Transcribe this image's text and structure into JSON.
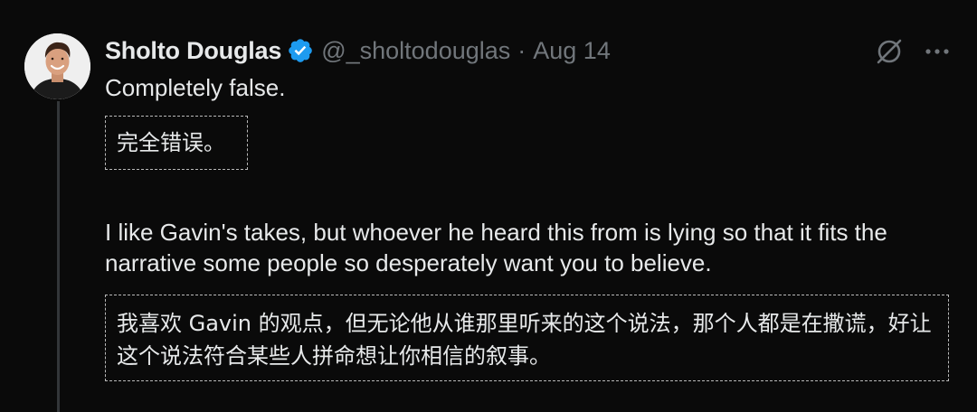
{
  "tweet": {
    "author": {
      "display_name": "Sholto Douglas",
      "handle": "@_sholtodouglas",
      "verified_icon": "verified-badge-icon",
      "avatar": "profile-photo"
    },
    "separator": "·",
    "date": "Aug 14",
    "actions": {
      "grok_icon": "grok-slash-icon",
      "more_label": "···"
    },
    "text_1": "Completely false.",
    "translation_1": "完全错误。",
    "text_2": "I like Gavin's takes, but whoever he heard this from is lying so that it fits the narrative some people so desperately want you to believe.",
    "translation_2": "我喜欢 Gavin 的观点，但无论他从谁那里听来的这个说法，那个人都是在撒谎，好让这个说法符合某些人拼命想让你相信的叙事。"
  },
  "colors": {
    "background": "#000000",
    "primary_text": "#e7e9ea",
    "secondary_text": "#71767b",
    "verified_blue": "#1d9bf0",
    "thread_line": "#333639",
    "dashed_border": "#b9b9b9"
  }
}
